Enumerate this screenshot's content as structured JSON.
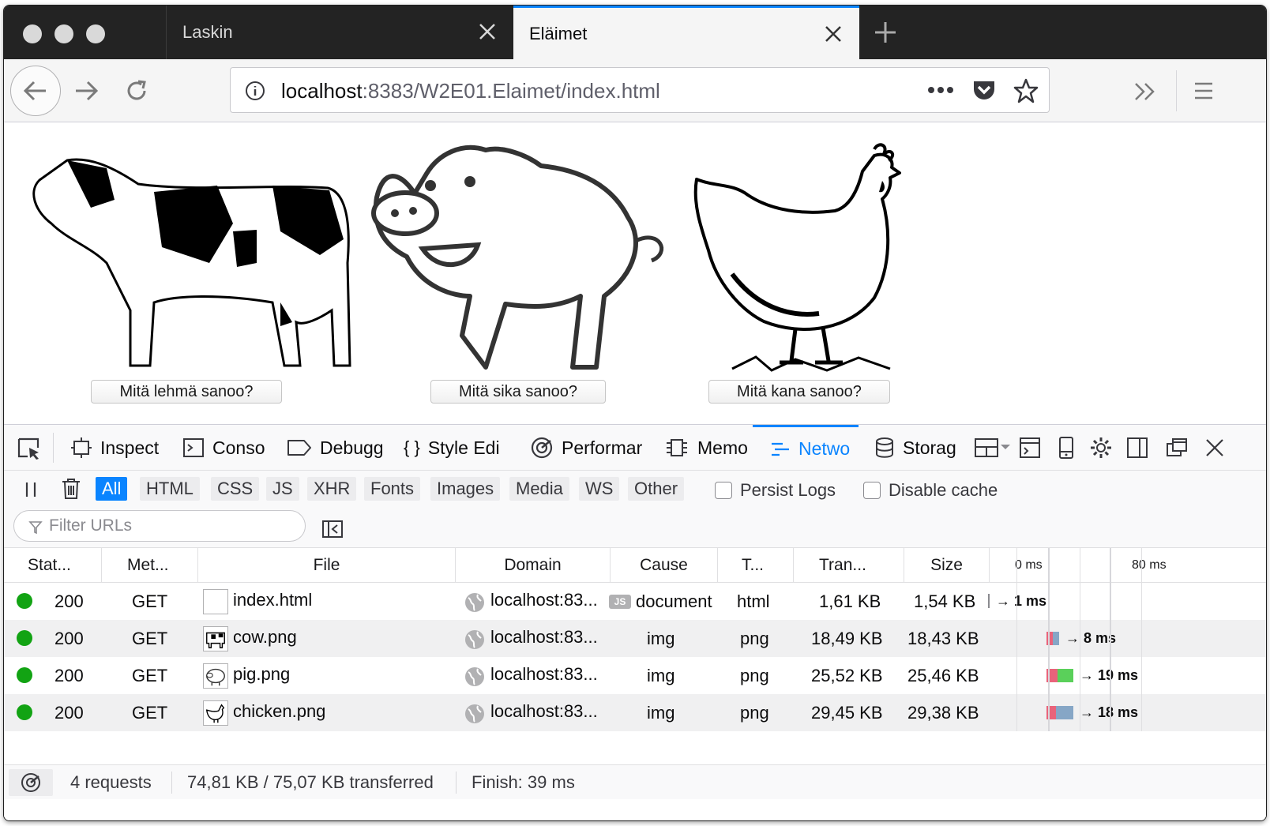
{
  "tabs": [
    {
      "title": "Laskin"
    },
    {
      "title": "Eläimet"
    }
  ],
  "url": {
    "host": "localhost",
    "rest": ":8383/W2E01.Elaimet/index.html"
  },
  "content": {
    "buttons": [
      "Mitä lehmä sanoo?",
      "Mitä sika sanoo?",
      "Mitä kana sanoo?"
    ]
  },
  "devtools": {
    "tabs": [
      "Inspect",
      "Conso",
      "Debugg",
      "Style Edi",
      "Performar",
      "Memo",
      "Netwo",
      "Storag"
    ],
    "active_tab": "Netwo",
    "filters": [
      "All",
      "HTML",
      "CSS",
      "JS",
      "XHR",
      "Fonts",
      "Images",
      "Media",
      "WS",
      "Other"
    ],
    "active_filter": "All",
    "checkboxes": {
      "persist": "Persist Logs",
      "disable_cache": "Disable cache"
    },
    "filter_placeholder": "Filter URLs",
    "columns": [
      "Stat...",
      "Met...",
      "File",
      "Domain",
      "Cause",
      "T...",
      "Tran...",
      "Size",
      "0 ms",
      "80 ms"
    ],
    "requests": [
      {
        "status": "200",
        "method": "GET",
        "file": "index.html",
        "domain": "localhost:83...",
        "cause": "document",
        "type": "html",
        "transferred": "1,61 KB",
        "size": "1,54 KB",
        "time": "→ 1 ms",
        "bar_colors": []
      },
      {
        "status": "200",
        "method": "GET",
        "file": "cow.png",
        "domain": "localhost:83...",
        "cause": "img",
        "type": "png",
        "transferred": "18,49 KB",
        "size": "18,43 KB",
        "time": "→ 8 ms",
        "bar_colors": [
          "#e9637b",
          "#86a6c6"
        ]
      },
      {
        "status": "200",
        "method": "GET",
        "file": "pig.png",
        "domain": "localhost:83...",
        "cause": "img",
        "type": "png",
        "transferred": "25,52 KB",
        "size": "25,46 KB",
        "time": "→ 19 ms",
        "bar_colors": [
          "#e9637b",
          "#5ad05a"
        ]
      },
      {
        "status": "200",
        "method": "GET",
        "file": "chicken.png",
        "domain": "localhost:83...",
        "cause": "img",
        "type": "png",
        "transferred": "29,45 KB",
        "size": "29,38 KB",
        "time": "→ 18 ms",
        "bar_colors": [
          "#e9637b",
          "#86a6c6"
        ]
      }
    ],
    "status": {
      "requests": "4 requests",
      "transferred": "74,81 KB / 75,07 KB transferred",
      "finish": "Finish: 39 ms"
    }
  },
  "colors": {
    "accent": "#0a84ff",
    "status_ok": "#12a313"
  }
}
